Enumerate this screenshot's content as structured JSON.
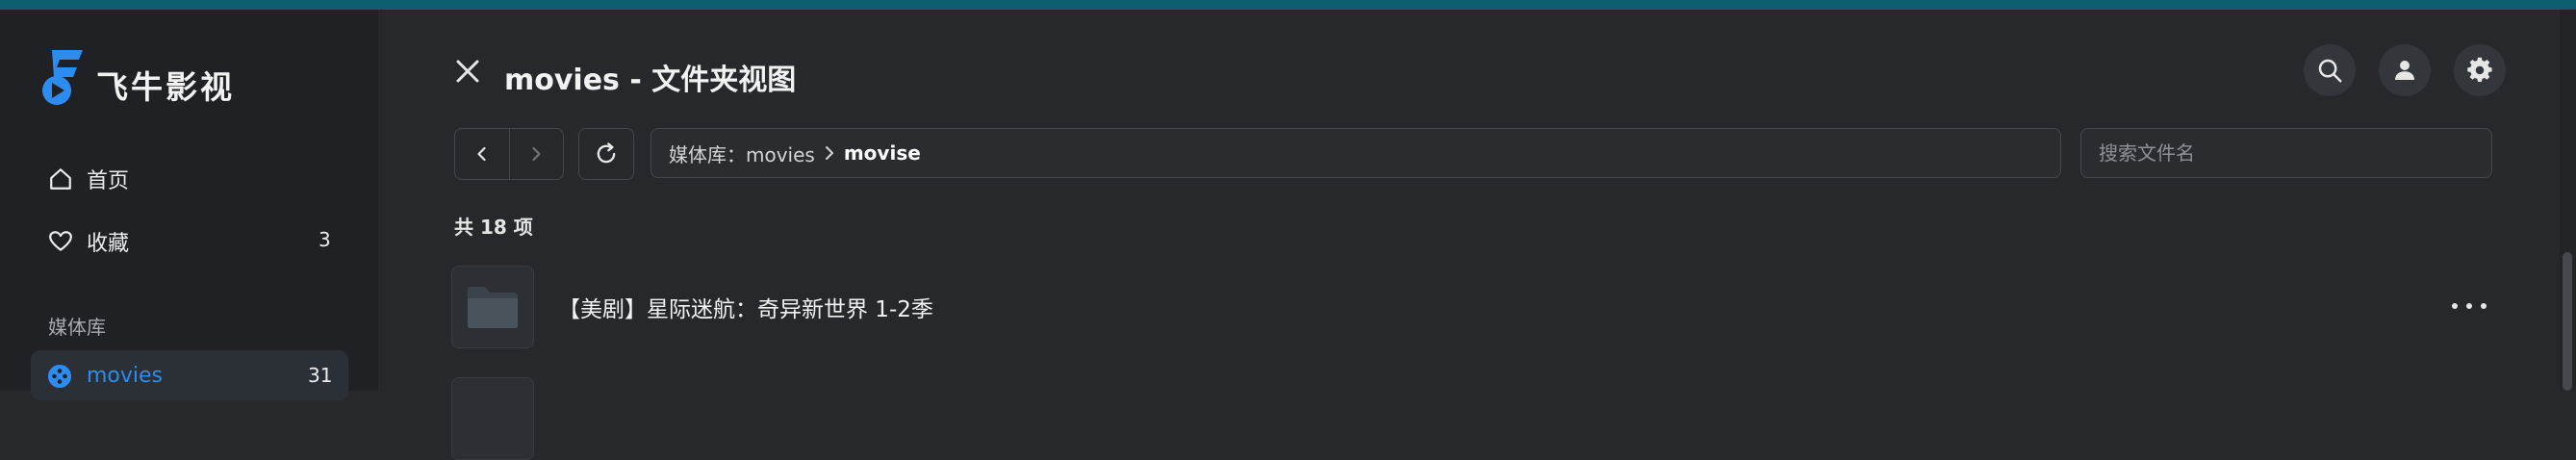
{
  "app": {
    "logo_text": "飞牛影视"
  },
  "sidebar": {
    "items": [
      {
        "label": "首页",
        "icon": "home-icon"
      },
      {
        "label": "收藏",
        "icon": "heart-icon",
        "count": "3"
      }
    ],
    "section_label": "媒体库",
    "libraries": [
      {
        "label": "movies",
        "count": "31",
        "icon": "film-reel-icon",
        "active": true
      }
    ]
  },
  "header": {
    "title": "movies - 文件夹视图",
    "actions": [
      "search-icon",
      "user-icon",
      "gear-icon"
    ]
  },
  "toolbar": {
    "breadcrumb": {
      "library": "媒体库：movies",
      "current": "movise"
    },
    "search_placeholder": "搜索文件名"
  },
  "content": {
    "count_label": "共 18 项",
    "items": [
      {
        "name": "【美剧】星际迷航：奇异新世界 1-2季",
        "type": "folder"
      }
    ]
  },
  "colors": {
    "accent": "#2d8cf0",
    "background": "#26282c",
    "sidebar": "#1f2124",
    "topbar": "#0b5f6f"
  }
}
